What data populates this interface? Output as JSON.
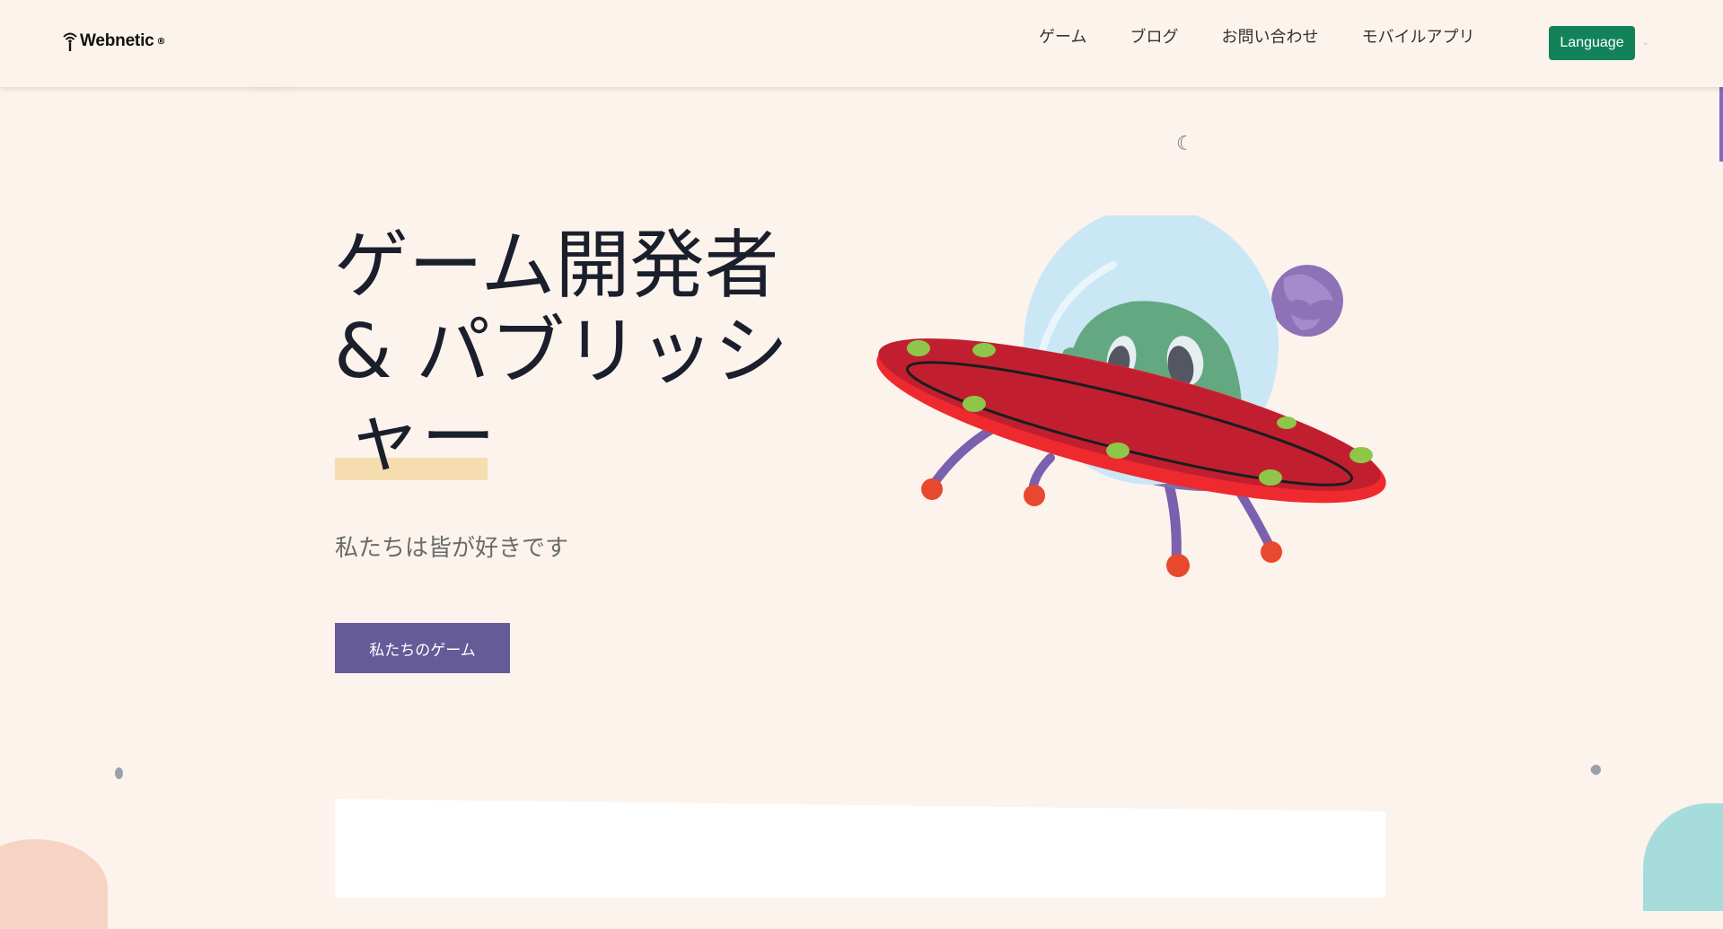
{
  "header": {
    "logo_text": "Webnetic",
    "logo_mark": "®",
    "nav": [
      "ゲーム",
      "ブログ",
      "お問い合わせ",
      "モバイルアプリ"
    ],
    "language_button": "Language"
  },
  "hero": {
    "title_lines": [
      "ゲーム開発者",
      "& パブリッシ",
      "ャー"
    ],
    "subtitle": "私たちは皆が好きです",
    "cta_label": "私たちのゲーム"
  },
  "icons": {
    "logo": "wifi-signal-icon",
    "language_caret": "chevron-down-icon"
  },
  "colors": {
    "background": "#fcf3ec",
    "language_button": "#12825a",
    "cta_button": "#655b99",
    "title_highlight": "#f6ddb0",
    "title_text": "#1a1f2b"
  }
}
